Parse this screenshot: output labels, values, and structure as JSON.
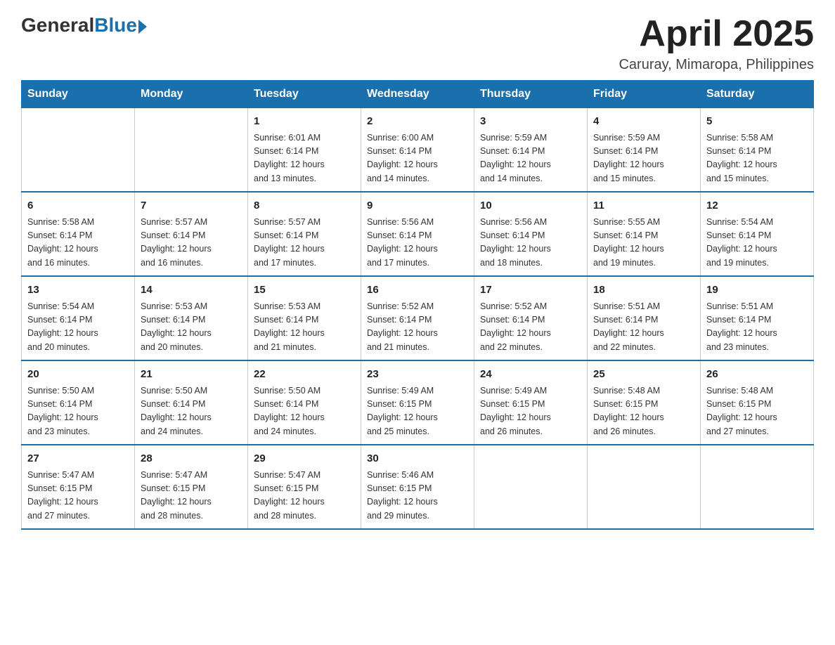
{
  "header": {
    "logo": {
      "general": "General",
      "blue": "Blue"
    },
    "title": "April 2025",
    "location": "Caruray, Mimaropa, Philippines"
  },
  "days_of_week": [
    "Sunday",
    "Monday",
    "Tuesday",
    "Wednesday",
    "Thursday",
    "Friday",
    "Saturday"
  ],
  "weeks": [
    [
      {
        "day": "",
        "info": ""
      },
      {
        "day": "",
        "info": ""
      },
      {
        "day": "1",
        "info": "Sunrise: 6:01 AM\nSunset: 6:14 PM\nDaylight: 12 hours\nand 13 minutes."
      },
      {
        "day": "2",
        "info": "Sunrise: 6:00 AM\nSunset: 6:14 PM\nDaylight: 12 hours\nand 14 minutes."
      },
      {
        "day": "3",
        "info": "Sunrise: 5:59 AM\nSunset: 6:14 PM\nDaylight: 12 hours\nand 14 minutes."
      },
      {
        "day": "4",
        "info": "Sunrise: 5:59 AM\nSunset: 6:14 PM\nDaylight: 12 hours\nand 15 minutes."
      },
      {
        "day": "5",
        "info": "Sunrise: 5:58 AM\nSunset: 6:14 PM\nDaylight: 12 hours\nand 15 minutes."
      }
    ],
    [
      {
        "day": "6",
        "info": "Sunrise: 5:58 AM\nSunset: 6:14 PM\nDaylight: 12 hours\nand 16 minutes."
      },
      {
        "day": "7",
        "info": "Sunrise: 5:57 AM\nSunset: 6:14 PM\nDaylight: 12 hours\nand 16 minutes."
      },
      {
        "day": "8",
        "info": "Sunrise: 5:57 AM\nSunset: 6:14 PM\nDaylight: 12 hours\nand 17 minutes."
      },
      {
        "day": "9",
        "info": "Sunrise: 5:56 AM\nSunset: 6:14 PM\nDaylight: 12 hours\nand 17 minutes."
      },
      {
        "day": "10",
        "info": "Sunrise: 5:56 AM\nSunset: 6:14 PM\nDaylight: 12 hours\nand 18 minutes."
      },
      {
        "day": "11",
        "info": "Sunrise: 5:55 AM\nSunset: 6:14 PM\nDaylight: 12 hours\nand 19 minutes."
      },
      {
        "day": "12",
        "info": "Sunrise: 5:54 AM\nSunset: 6:14 PM\nDaylight: 12 hours\nand 19 minutes."
      }
    ],
    [
      {
        "day": "13",
        "info": "Sunrise: 5:54 AM\nSunset: 6:14 PM\nDaylight: 12 hours\nand 20 minutes."
      },
      {
        "day": "14",
        "info": "Sunrise: 5:53 AM\nSunset: 6:14 PM\nDaylight: 12 hours\nand 20 minutes."
      },
      {
        "day": "15",
        "info": "Sunrise: 5:53 AM\nSunset: 6:14 PM\nDaylight: 12 hours\nand 21 minutes."
      },
      {
        "day": "16",
        "info": "Sunrise: 5:52 AM\nSunset: 6:14 PM\nDaylight: 12 hours\nand 21 minutes."
      },
      {
        "day": "17",
        "info": "Sunrise: 5:52 AM\nSunset: 6:14 PM\nDaylight: 12 hours\nand 22 minutes."
      },
      {
        "day": "18",
        "info": "Sunrise: 5:51 AM\nSunset: 6:14 PM\nDaylight: 12 hours\nand 22 minutes."
      },
      {
        "day": "19",
        "info": "Sunrise: 5:51 AM\nSunset: 6:14 PM\nDaylight: 12 hours\nand 23 minutes."
      }
    ],
    [
      {
        "day": "20",
        "info": "Sunrise: 5:50 AM\nSunset: 6:14 PM\nDaylight: 12 hours\nand 23 minutes."
      },
      {
        "day": "21",
        "info": "Sunrise: 5:50 AM\nSunset: 6:14 PM\nDaylight: 12 hours\nand 24 minutes."
      },
      {
        "day": "22",
        "info": "Sunrise: 5:50 AM\nSunset: 6:14 PM\nDaylight: 12 hours\nand 24 minutes."
      },
      {
        "day": "23",
        "info": "Sunrise: 5:49 AM\nSunset: 6:15 PM\nDaylight: 12 hours\nand 25 minutes."
      },
      {
        "day": "24",
        "info": "Sunrise: 5:49 AM\nSunset: 6:15 PM\nDaylight: 12 hours\nand 26 minutes."
      },
      {
        "day": "25",
        "info": "Sunrise: 5:48 AM\nSunset: 6:15 PM\nDaylight: 12 hours\nand 26 minutes."
      },
      {
        "day": "26",
        "info": "Sunrise: 5:48 AM\nSunset: 6:15 PM\nDaylight: 12 hours\nand 27 minutes."
      }
    ],
    [
      {
        "day": "27",
        "info": "Sunrise: 5:47 AM\nSunset: 6:15 PM\nDaylight: 12 hours\nand 27 minutes."
      },
      {
        "day": "28",
        "info": "Sunrise: 5:47 AM\nSunset: 6:15 PM\nDaylight: 12 hours\nand 28 minutes."
      },
      {
        "day": "29",
        "info": "Sunrise: 5:47 AM\nSunset: 6:15 PM\nDaylight: 12 hours\nand 28 minutes."
      },
      {
        "day": "30",
        "info": "Sunrise: 5:46 AM\nSunset: 6:15 PM\nDaylight: 12 hours\nand 29 minutes."
      },
      {
        "day": "",
        "info": ""
      },
      {
        "day": "",
        "info": ""
      },
      {
        "day": "",
        "info": ""
      }
    ]
  ]
}
